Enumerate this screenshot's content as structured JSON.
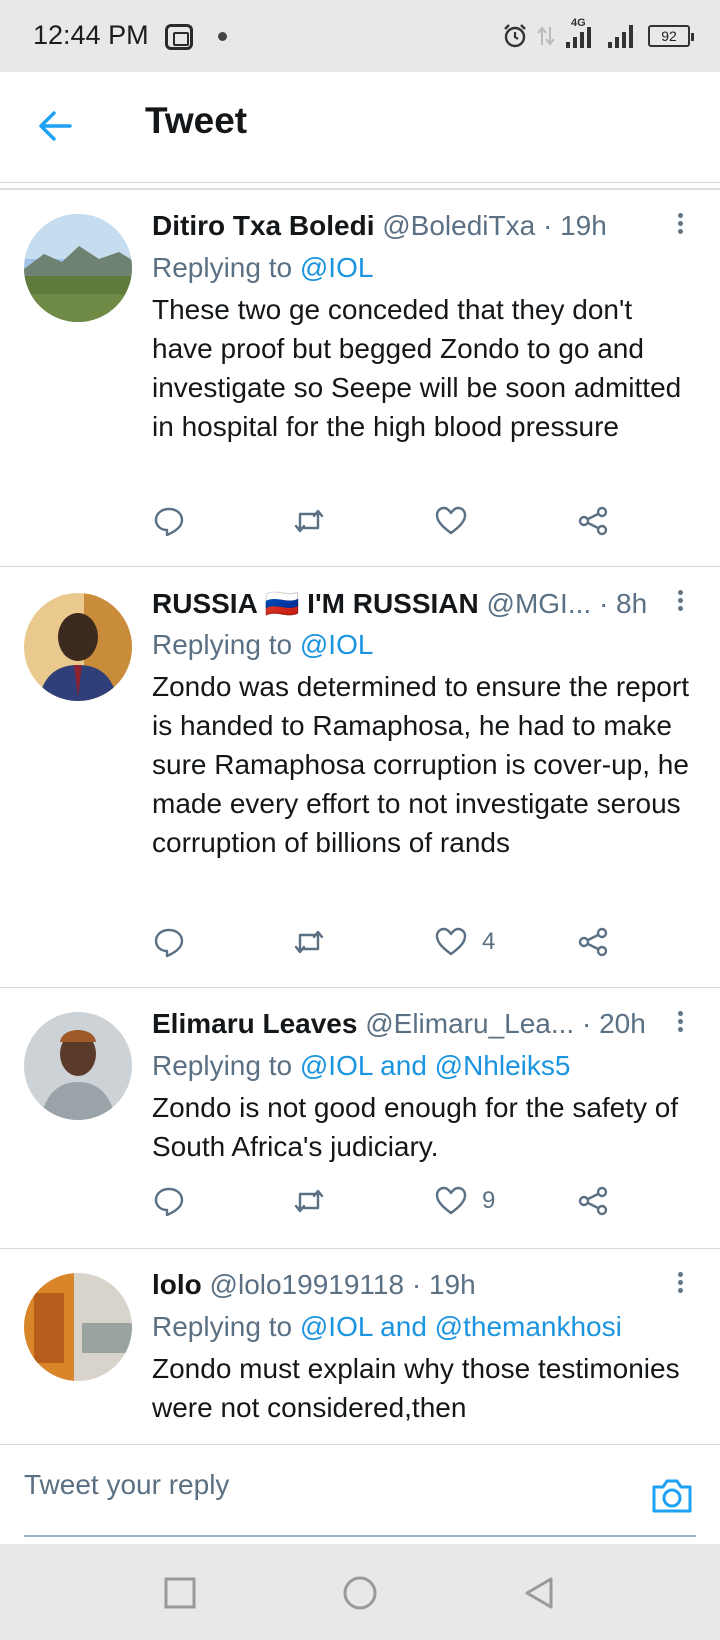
{
  "status": {
    "time": "12:44 PM",
    "network": "4G",
    "battery": "92"
  },
  "header": {
    "title": "Tweet"
  },
  "tweets": [
    {
      "name": "Ditiro Txa Boledi",
      "handle": "@BolediTxa · 19h",
      "replying_prefix": "Replying to ",
      "replying_to": "@IOL",
      "text": "These two ge conceded that they don't have proof but begged Zondo to go and investigate so Seepe will be soon admitted in hospital for the high blood pressure",
      "likes": ""
    },
    {
      "name": "RUSSIA 🇷🇺 I'M RUSSIAN",
      "handle": "@MGI... · 8h",
      "replying_prefix": "Replying to ",
      "replying_to": "@IOL",
      "text": "Zondo was determined to ensure the report is handed to Ramaphosa, he had to make sure Ramaphosa corruption is cover-up, he made every effort to not investigate serous corruption of billions of rands",
      "likes": "4"
    },
    {
      "name": "Elimaru Leaves",
      "handle": "@Elimaru_Lea... · 20h",
      "replying_prefix": "Replying to ",
      "replying_to": "@IOL and @Nhleiks5",
      "text": "Zondo is not good enough for the safety of South Africa's judiciary.",
      "likes": "9"
    },
    {
      "name": "lolo",
      "handle": "@lolo19919118 · 19h",
      "replying_prefix": "Replying to ",
      "replying_to": "@IOL and @themankhosi",
      "text": "Zondo must explain why those testimonies were not considered,then",
      "likes": ""
    }
  ],
  "reply": {
    "placeholder": "Tweet your reply"
  },
  "icons": {
    "back": "back-arrow-icon",
    "reply": "comment-icon",
    "retweet": "retweet-icon",
    "like": "heart-icon",
    "share": "share-icon",
    "camera": "camera-icon",
    "more": "more-vertical-icon"
  },
  "colors": {
    "accent": "#1da1f2",
    "text": "#14171a",
    "muted": "#5b7083"
  }
}
